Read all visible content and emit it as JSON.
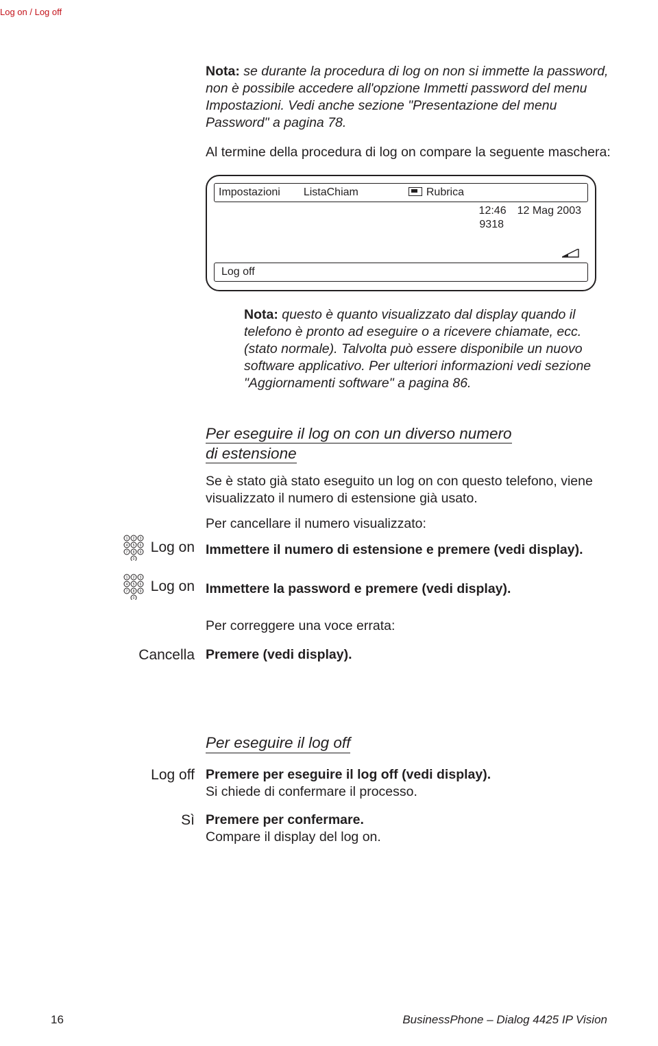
{
  "header": {
    "running": "Log on / Log off"
  },
  "note1": {
    "label": "Nota:",
    "text": " se durante la procedura di log on non si immette la password, non è possibile accedere all'opzione Immetti password del menu Impostazioni. Vedi anche sezione \"Presentazione del menu Password\" a pagina 78."
  },
  "after_note": "Al termine della procedura di log on compare la seguente maschera:",
  "screen": {
    "tabs": {
      "impostazioni": "Impostazioni",
      "listachiam": "ListaChiam",
      "rubrica": "Rubrica"
    },
    "time": "12:46",
    "date": "12 Mag 2003",
    "ext": "9318",
    "logoff": "Log off"
  },
  "note2": {
    "label": "Nota:",
    "text": " questo è quanto visualizzato dal display quando il telefono è pronto ad eseguire o a ricevere chiamate, ecc. (stato normale). Talvolta può essere disponibile un nuovo software applicativo. Per ulteriori informazioni vedi sezione \"Aggiornamenti software\" a pagina 86."
  },
  "section_a": {
    "title_l1": "Per eseguire il log on con un diverso numero",
    "title_l2": "di estensione",
    "p1": "Se è stato già stato eseguito un log on con questo telefono, viene visualizzato il numero di estensione già usato.",
    "p2": "Per cancellare il numero visualizzato:",
    "logon1_left": "Log on",
    "logon1_text": "Immettere il numero di estensione e premere (vedi display).",
    "logon2_left": "Log on",
    "logon2_text": "Immettere la password e premere (vedi display).",
    "correct": "Per correggere una voce errata:",
    "cancel_left": "Cancella",
    "cancel_text": "Premere (vedi display)."
  },
  "section_b": {
    "title": "Per eseguire il log off",
    "logoff_left": "Log off",
    "logoff_text": "Premere per eseguire il log off (vedi display).",
    "logoff_sub": "Si chiede di confermare il processo.",
    "si_left": "Sì",
    "si_text": "Premere per confermare.",
    "si_sub": "Compare il display del log on."
  },
  "footer": {
    "page": "16",
    "product": "BusinessPhone – Dialog 4425 IP Vision"
  }
}
